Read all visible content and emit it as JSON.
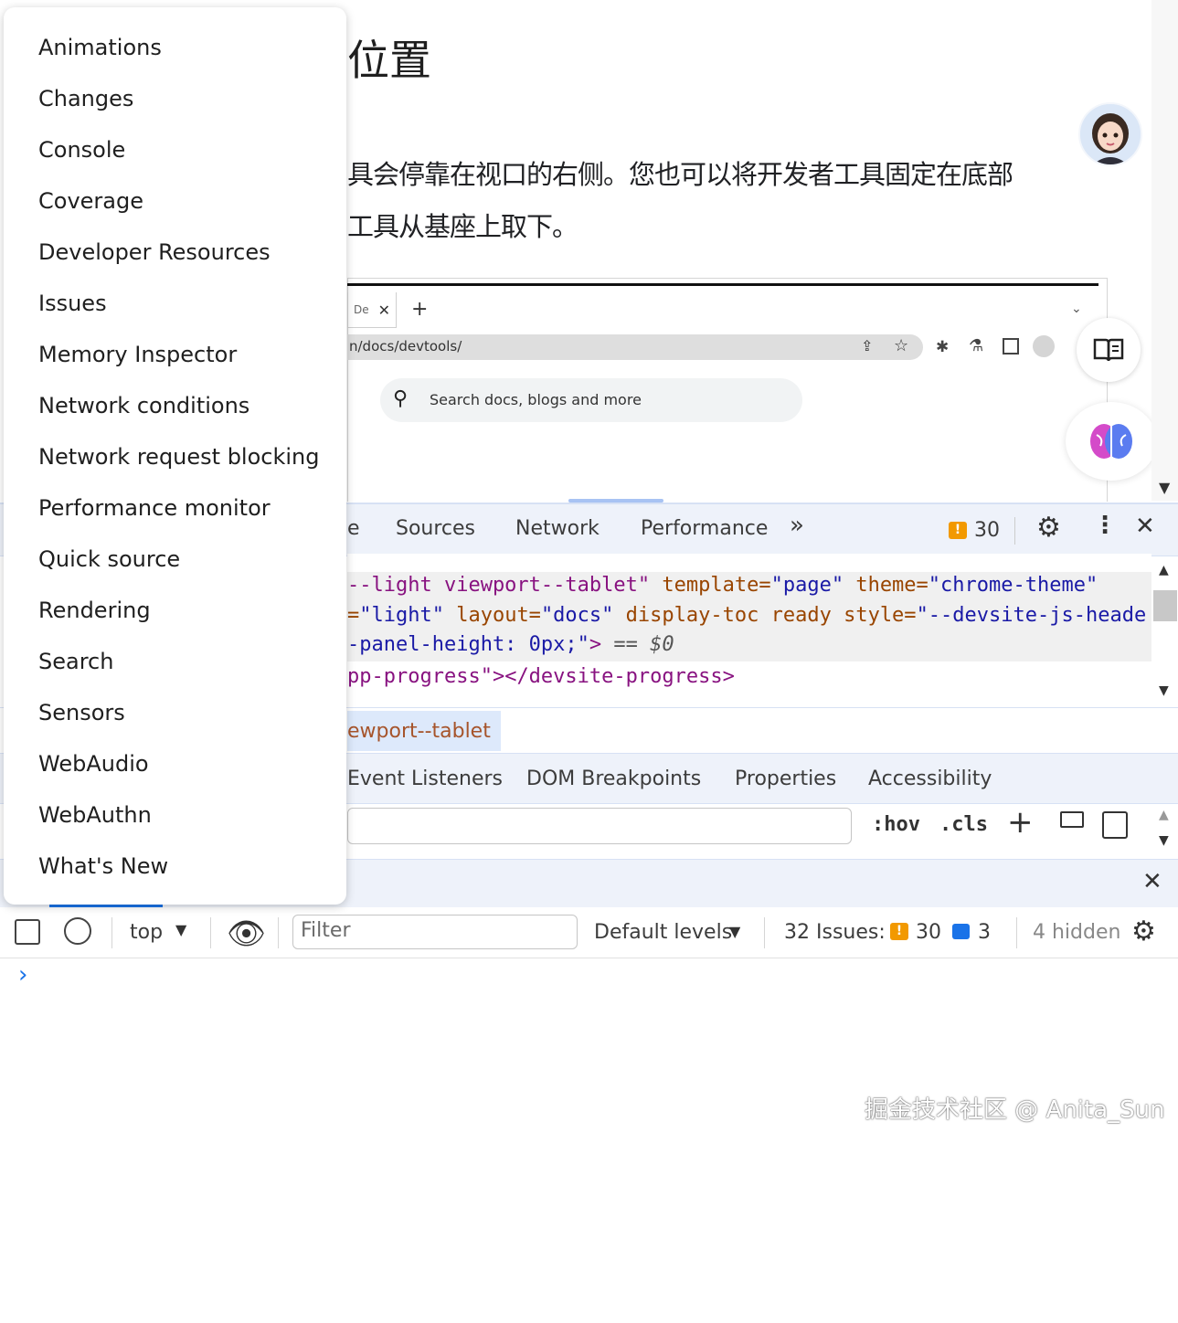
{
  "page": {
    "heading": "位置",
    "paragraph_line1": "具会停靠在视口的右侧。您也可以将开发者工具固定在底部",
    "paragraph_line2": "工具从基座上取下。"
  },
  "screenshot": {
    "tab_label": "De",
    "url": "n/docs/devtools/",
    "search_placeholder": "Search docs, blogs and more"
  },
  "devtools": {
    "tabs": [
      {
        "label": "e"
      },
      {
        "label": "Sources"
      },
      {
        "label": "Network"
      },
      {
        "label": "Performance"
      }
    ],
    "issues_count": "30",
    "code_lines": [
      {
        "parts": [
          "--light viewport--tablet\"",
          " template=",
          "\"page\"",
          " theme=",
          "\"chrome-theme\""
        ]
      },
      {
        "parts": [
          "=",
          "\"light\"",
          " layout=",
          "\"docs\"",
          " display-toc ready style=",
          "\"--devsite-js-heade"
        ]
      },
      {
        "parts": [
          "-panel-height: 0px;\"",
          ">",
          " == $0"
        ]
      },
      {
        "parts": [
          "pp-progress",
          "\"></devsite-progress>"
        ]
      }
    ],
    "breadcrumb": "ewport--tablet",
    "subtabs": [
      {
        "label": "Event Listeners"
      },
      {
        "label": "DOM Breakpoints"
      },
      {
        "label": "Properties"
      },
      {
        "label": "Accessibility"
      }
    ],
    "styles_toolbar": {
      "hov": ":hov",
      "cls": ".cls"
    }
  },
  "console": {
    "context": "top",
    "filter_placeholder": "Filter",
    "levels": "Default levels",
    "issues_label": "32 Issues:",
    "issues_warning_count": "30",
    "issues_info_count": "3",
    "hidden": "4 hidden",
    "prompt": "›"
  },
  "menu": {
    "items": [
      "Animations",
      "Changes",
      "Console",
      "Coverage",
      "Developer Resources",
      "Issues",
      "Memory Inspector",
      "Network conditions",
      "Network request blocking",
      "Performance monitor",
      "Quick source",
      "Rendering",
      "Search",
      "Sensors",
      "WebAudio",
      "WebAuthn",
      "What's New"
    ]
  },
  "watermark": "掘金技术社区 @ Anita_Sun",
  "colors": {
    "toolbar_bg": "#eef2fa",
    "warning": "#f29900",
    "info": "#1a73e8",
    "tag": "#881280",
    "attr": "#994500",
    "value": "#1a1aa6"
  }
}
